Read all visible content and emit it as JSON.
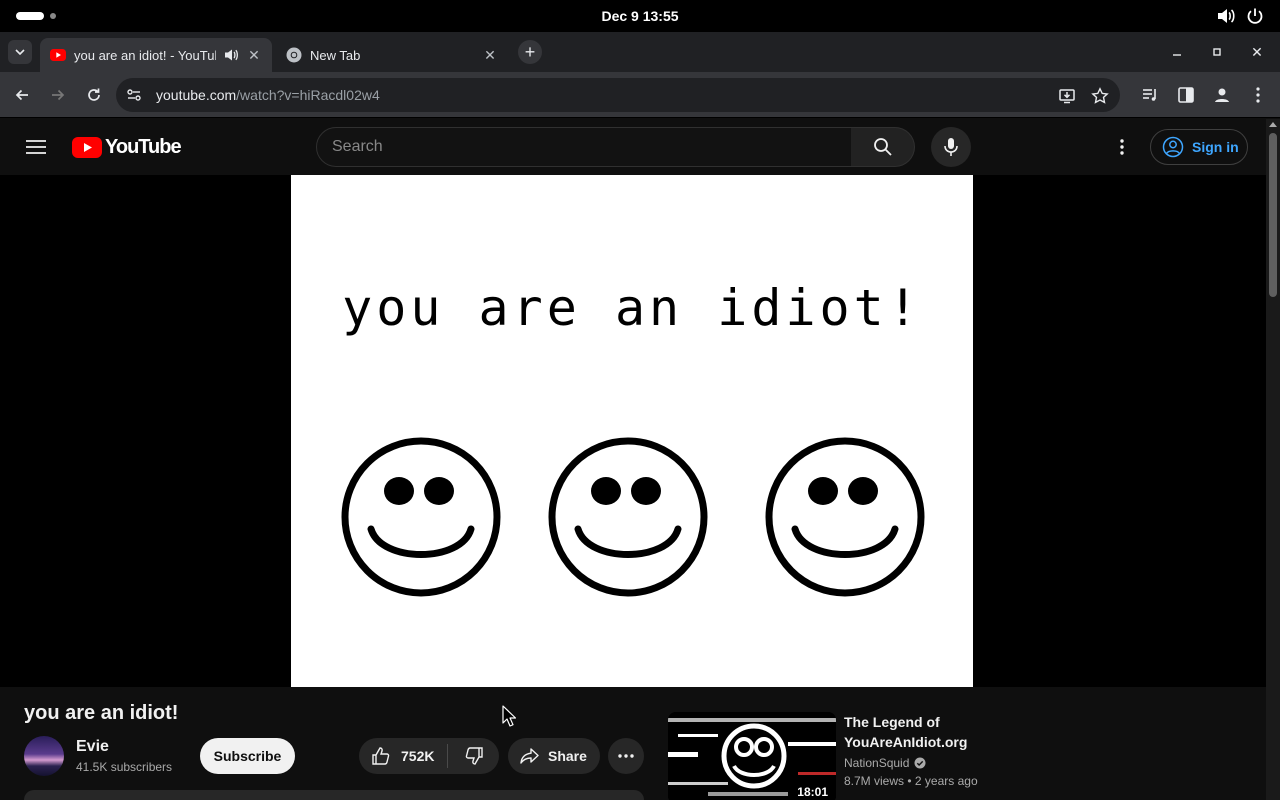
{
  "os": {
    "clock": "Dec 9  13:55",
    "icons": [
      "volume-icon",
      "power-icon"
    ]
  },
  "browser": {
    "tabs": [
      {
        "title": "you are an idiot! - YouTube",
        "active": true,
        "audio": true
      },
      {
        "title": "New Tab",
        "active": false
      }
    ],
    "url": {
      "host": "youtube.com",
      "path": "/watch?v=hiRacdl02w4"
    }
  },
  "youtube": {
    "logo_text": "YouTube",
    "search_placeholder": "Search",
    "sign_in_label": "Sign in",
    "brand_color": "#ff0000",
    "link_color": "#3ea6ff"
  },
  "player": {
    "caption": "you are an idiot!",
    "smiley_count": 3
  },
  "video": {
    "title": "you are an idiot!",
    "channel": "Evie",
    "subscribers": "41.5K subscribers",
    "subscribe_label": "Subscribe",
    "likes": "752K",
    "share_label": "Share"
  },
  "recommendation": {
    "title": "The Legend of YouAreAnIdiot.org",
    "channel": "NationSquid",
    "verified": true,
    "views": "8.7M views",
    "age": "2 years ago",
    "duration": "18:01"
  }
}
